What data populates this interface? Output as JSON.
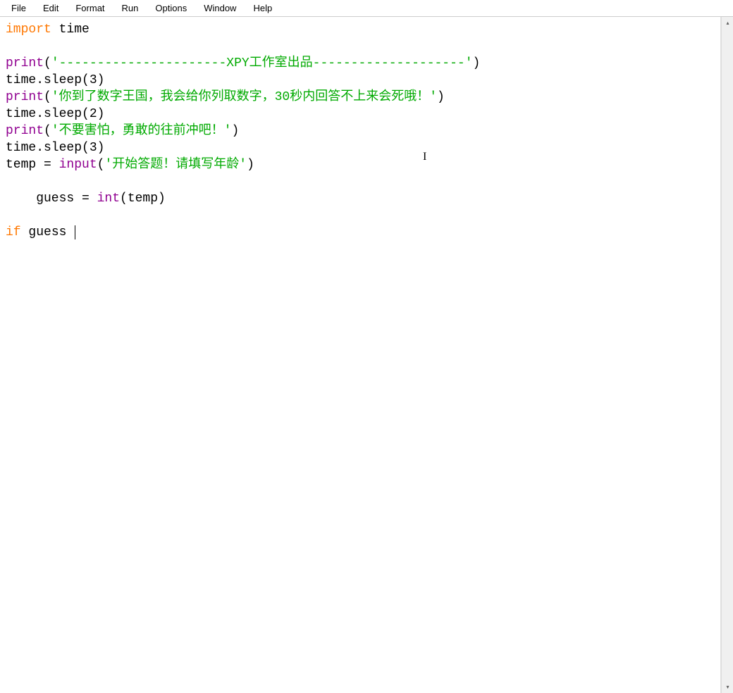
{
  "menubar": {
    "items": [
      "File",
      "Edit",
      "Format",
      "Run",
      "Options",
      "Window",
      "Help"
    ]
  },
  "code": {
    "line1": {
      "kw": "import",
      "mod": " time"
    },
    "line2": "",
    "line3": {
      "fn": "print",
      "open": "(",
      "str": "'----------------------XPY工作室出品--------------------'",
      "close": ")"
    },
    "line4": {
      "obj": "time.sleep(",
      "num": "3",
      "close": ")"
    },
    "line5": {
      "fn": "print",
      "open": "(",
      "str": "'你到了数字王国，我会给你列取数字，30秒内回答不上来会死哦！'",
      "close": ")"
    },
    "line6": {
      "obj": "time.sleep(",
      "num": "2",
      "close": ")"
    },
    "line7": {
      "fn": "print",
      "open": "(",
      "str": "'不要害怕，勇敢的往前冲吧！'",
      "close": ")"
    },
    "line8": {
      "obj": "time.sleep(",
      "num": "3",
      "close": ")"
    },
    "line9": {
      "pre": "temp = ",
      "fn": "input",
      "open": "(",
      "str": "'开始答题！请填写年龄'",
      "close": ")"
    },
    "line10": "",
    "line11": {
      "indent": "    guess = ",
      "fn": "int",
      "rest": "(temp)"
    },
    "line12": "",
    "line13": {
      "kw": "if",
      "rest": " guess "
    }
  },
  "scrollbar": {
    "up": "▴",
    "down": "▾"
  }
}
